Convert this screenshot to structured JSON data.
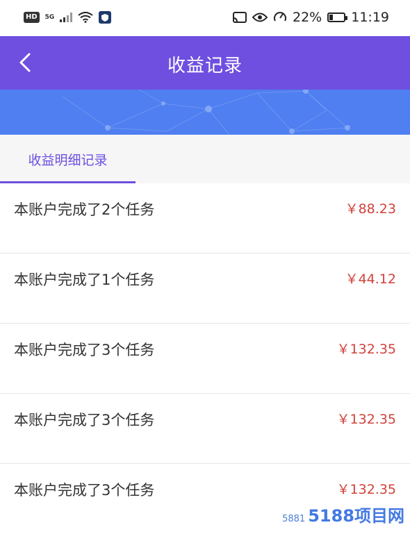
{
  "status_bar": {
    "hd": "HD",
    "signal": "5G",
    "battery": "22%",
    "battery_level": 0.22,
    "time": "11:19",
    "icons": [
      "wifi-icon",
      "shield-icon",
      "cast-icon",
      "eye-icon",
      "speed-icon",
      "battery-icon"
    ]
  },
  "header": {
    "title": "收益记录",
    "back_icon": "chevron-left-icon"
  },
  "tabs": [
    {
      "label": "收益明细记录",
      "active": true
    }
  ],
  "records": [
    {
      "text": "本账户完成了2个任务",
      "amount": "￥88.23"
    },
    {
      "text": "本账户完成了1个任务",
      "amount": "￥44.12"
    },
    {
      "text": "本账户完成了3个任务",
      "amount": "￥132.35"
    },
    {
      "text": "本账户完成了3个任务",
      "amount": "￥132.35"
    },
    {
      "text": "本账户完成了3个任务",
      "amount": "￥132.35"
    }
  ],
  "watermark": {
    "small": "5881",
    "big": "5188项目网"
  },
  "colors": {
    "header": "#6e4fe0",
    "banner": "#4f7ff0",
    "amount": "#d0423b",
    "tab_active": "#6e4fe0"
  }
}
